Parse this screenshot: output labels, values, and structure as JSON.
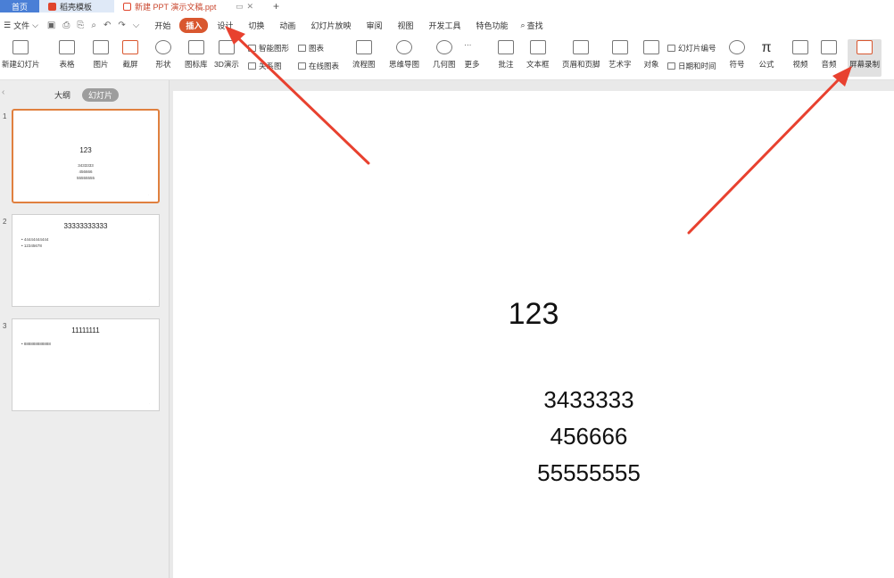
{
  "tabs": {
    "home": "首页",
    "template": "稻壳模板",
    "doc": "新建 PPT 演示文稿.ppt",
    "add": "+"
  },
  "menu": {
    "file": "文件",
    "tabs": [
      "开始",
      "插入",
      "设计",
      "切换",
      "动画",
      "幻灯片放映",
      "审阅",
      "视图",
      "开发工具",
      "特色功能"
    ],
    "active_tab": "插入",
    "search": "查找"
  },
  "ribbon": {
    "new_slide": "新建幻灯片",
    "table": "表格",
    "picture": "图片",
    "screenshot": "截屏",
    "shape": "形状",
    "icon_lib": "图标库",
    "d3": "3D演示",
    "smart_art": "智能图形",
    "chart": "图表",
    "relation": "关系图",
    "online_chart": "在线图表",
    "flowchart": "流程图",
    "mindmap": "思维导图",
    "geometry": "几何图",
    "more": "更多",
    "comment": "批注",
    "textbox": "文本框",
    "header_footer": "页眉和页脚",
    "wordart": "艺术字",
    "object": "对象",
    "slide_number": "幻灯片编号",
    "datetime": "日期和时间",
    "symbol": "符号",
    "formula": "公式",
    "video": "视频",
    "audio": "音频",
    "screen_record": "屏幕录制"
  },
  "sidebar": {
    "tab_outline": "大纲",
    "tab_slides": "幻灯片",
    "slides": [
      {
        "num": "1",
        "title": "123",
        "lines": [
          "3433333",
          "456666",
          "55555555"
        ]
      },
      {
        "num": "2",
        "title": "33333333333",
        "bullets": [
          "• 44444444444",
          "• 12345678"
        ]
      },
      {
        "num": "3",
        "title": "11111111",
        "bullets": [
          "• 888888888888"
        ]
      }
    ]
  },
  "slide": {
    "title": "123",
    "lines": [
      "3433333",
      "456666",
      "55555555"
    ]
  },
  "colors": {
    "accent": "#d9572f",
    "arrow": "#e8412f",
    "home_tab": "#4a7fd6"
  }
}
